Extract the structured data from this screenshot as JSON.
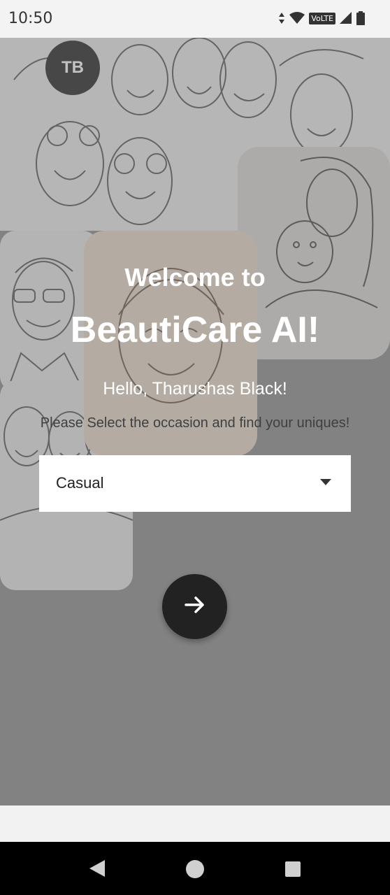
{
  "status_bar": {
    "time": "10:50",
    "network_label": "VoLTE",
    "icons": [
      "data-arrows-icon",
      "wifi-icon",
      "volte-icon",
      "signal-icon",
      "battery-icon"
    ]
  },
  "profile": {
    "initials": "TB"
  },
  "hero": {
    "welcome": "Welcome to",
    "brand": "BeautiCare AI!"
  },
  "greeting": "Hello, Tharushas Black!",
  "subtitle": "Please Select the occasion and find your uniques!",
  "occasion_select": {
    "selected": "Casual"
  },
  "next_button": {
    "icon": "arrow-right-icon"
  },
  "navigation_bar": {
    "icons": [
      "back-icon",
      "home-icon",
      "recents-icon"
    ]
  },
  "colors": {
    "background_gray": "#8a8a8a",
    "button_dark": "#222222",
    "text_white": "#ffffff"
  }
}
